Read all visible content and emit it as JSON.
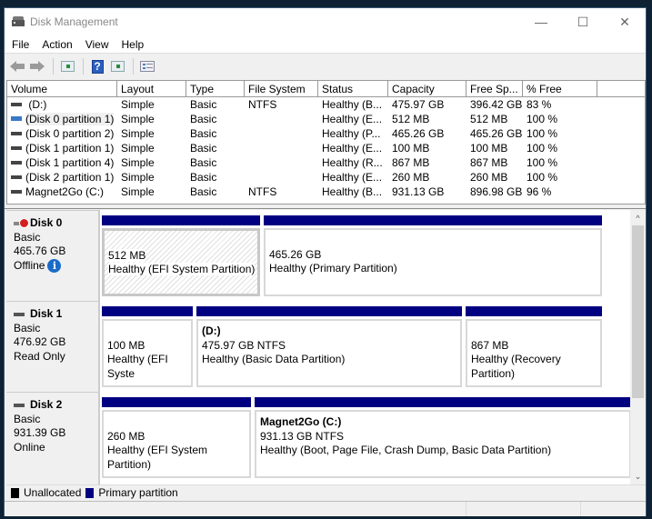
{
  "window": {
    "title": "Disk Management",
    "controls": {
      "minimize": "—",
      "maximize": "☐",
      "close": "✕"
    }
  },
  "menu": [
    "File",
    "Action",
    "View",
    "Help"
  ],
  "toolbar": {
    "buttons": [
      {
        "name": "back-button",
        "icon": "back-arrow-icon"
      },
      {
        "name": "forward-button",
        "icon": "forward-arrow-icon"
      },
      {
        "name": "show-hide-console-tree-button",
        "icon": "console-tree-icon"
      },
      {
        "name": "help-button",
        "icon": "help-icon",
        "glyph": "?"
      },
      {
        "name": "show-hide-action-pane-button",
        "icon": "action-pane-icon"
      },
      {
        "name": "properties-button",
        "icon": "properties-icon"
      }
    ]
  },
  "volume_list": {
    "columns": [
      "Volume",
      "Layout",
      "Type",
      "File System",
      "Status",
      "Capacity",
      "Free Sp...",
      "% Free"
    ],
    "rows": [
      {
        "volume": " (D:)",
        "layout": "Simple",
        "type": "Basic",
        "fs": "NTFS",
        "status": "Healthy (B...",
        "capacity": "475.97 GB",
        "free": "396.42 GB",
        "pct": "83 %",
        "icon": "volume-icon"
      },
      {
        "volume": "(Disk 0 partition 1)",
        "layout": "Simple",
        "type": "Basic",
        "fs": "",
        "status": "Healthy (E...",
        "capacity": "512 MB",
        "free": "512 MB",
        "pct": "100 %",
        "icon": "volume-icon-offline"
      },
      {
        "volume": "(Disk 0 partition 2)",
        "layout": "Simple",
        "type": "Basic",
        "fs": "",
        "status": "Healthy (P...",
        "capacity": "465.26 GB",
        "free": "465.26 GB",
        "pct": "100 %",
        "icon": "volume-icon"
      },
      {
        "volume": "(Disk 1 partition 1)",
        "layout": "Simple",
        "type": "Basic",
        "fs": "",
        "status": "Healthy (E...",
        "capacity": "100 MB",
        "free": "100 MB",
        "pct": "100 %",
        "icon": "volume-icon"
      },
      {
        "volume": "(Disk 1 partition 4)",
        "layout": "Simple",
        "type": "Basic",
        "fs": "",
        "status": "Healthy (R...",
        "capacity": "867 MB",
        "free": "867 MB",
        "pct": "100 %",
        "icon": "volume-icon"
      },
      {
        "volume": "(Disk 2 partition 1)",
        "layout": "Simple",
        "type": "Basic",
        "fs": "",
        "status": "Healthy (E...",
        "capacity": "260 MB",
        "free": "260 MB",
        "pct": "100 %",
        "icon": "volume-icon"
      },
      {
        "volume": "Magnet2Go (C:)",
        "layout": "Simple",
        "type": "Basic",
        "fs": "NTFS",
        "status": "Healthy (B...",
        "capacity": "931.13 GB",
        "free": "896.98 GB",
        "pct": "96 %",
        "icon": "volume-icon"
      }
    ]
  },
  "disks": [
    {
      "name": "Disk 0",
      "type": "Basic",
      "size": "465.76 GB",
      "state": "Offline",
      "has_info": true,
      "partitions": [
        {
          "name": "",
          "size": "512 MB",
          "status": "Healthy (EFI System Partition)",
          "hatched": true
        },
        {
          "name": "",
          "size": "465.26 GB",
          "status": "Healthy (Primary Partition)",
          "hatched": false
        }
      ]
    },
    {
      "name": "Disk 1",
      "type": "Basic",
      "size": "476.92 GB",
      "state": "Read Only",
      "has_info": false,
      "partitions": [
        {
          "name": "",
          "size": "100 MB",
          "status": "Healthy (EFI Syste",
          "hatched": false
        },
        {
          "name": " (D:)",
          "size": "475.97 GB NTFS",
          "status": "Healthy (Basic Data Partition)",
          "hatched": false
        },
        {
          "name": "",
          "size": "867 MB",
          "status": "Healthy (Recovery Partition)",
          "hatched": false
        }
      ]
    },
    {
      "name": "Disk 2",
      "type": "Basic",
      "size": "931.39 GB",
      "state": "Online",
      "has_info": false,
      "partitions": [
        {
          "name": "",
          "size": "260 MB",
          "status": "Healthy (EFI System Partition)",
          "hatched": false
        },
        {
          "name": "Magnet2Go  (C:)",
          "size": "931.13 GB NTFS",
          "status": "Healthy (Boot, Page File, Crash Dump, Basic Data Partition)",
          "hatched": false
        }
      ]
    }
  ],
  "legend": [
    {
      "label": "Unallocated",
      "color": "#000000"
    },
    {
      "label": "Primary partition",
      "color": "#000080"
    }
  ],
  "colors": {
    "primary_partition": "#000080",
    "unallocated": "#000000",
    "info_icon": "#1a6cc8",
    "offline_badge": "#d32020"
  }
}
